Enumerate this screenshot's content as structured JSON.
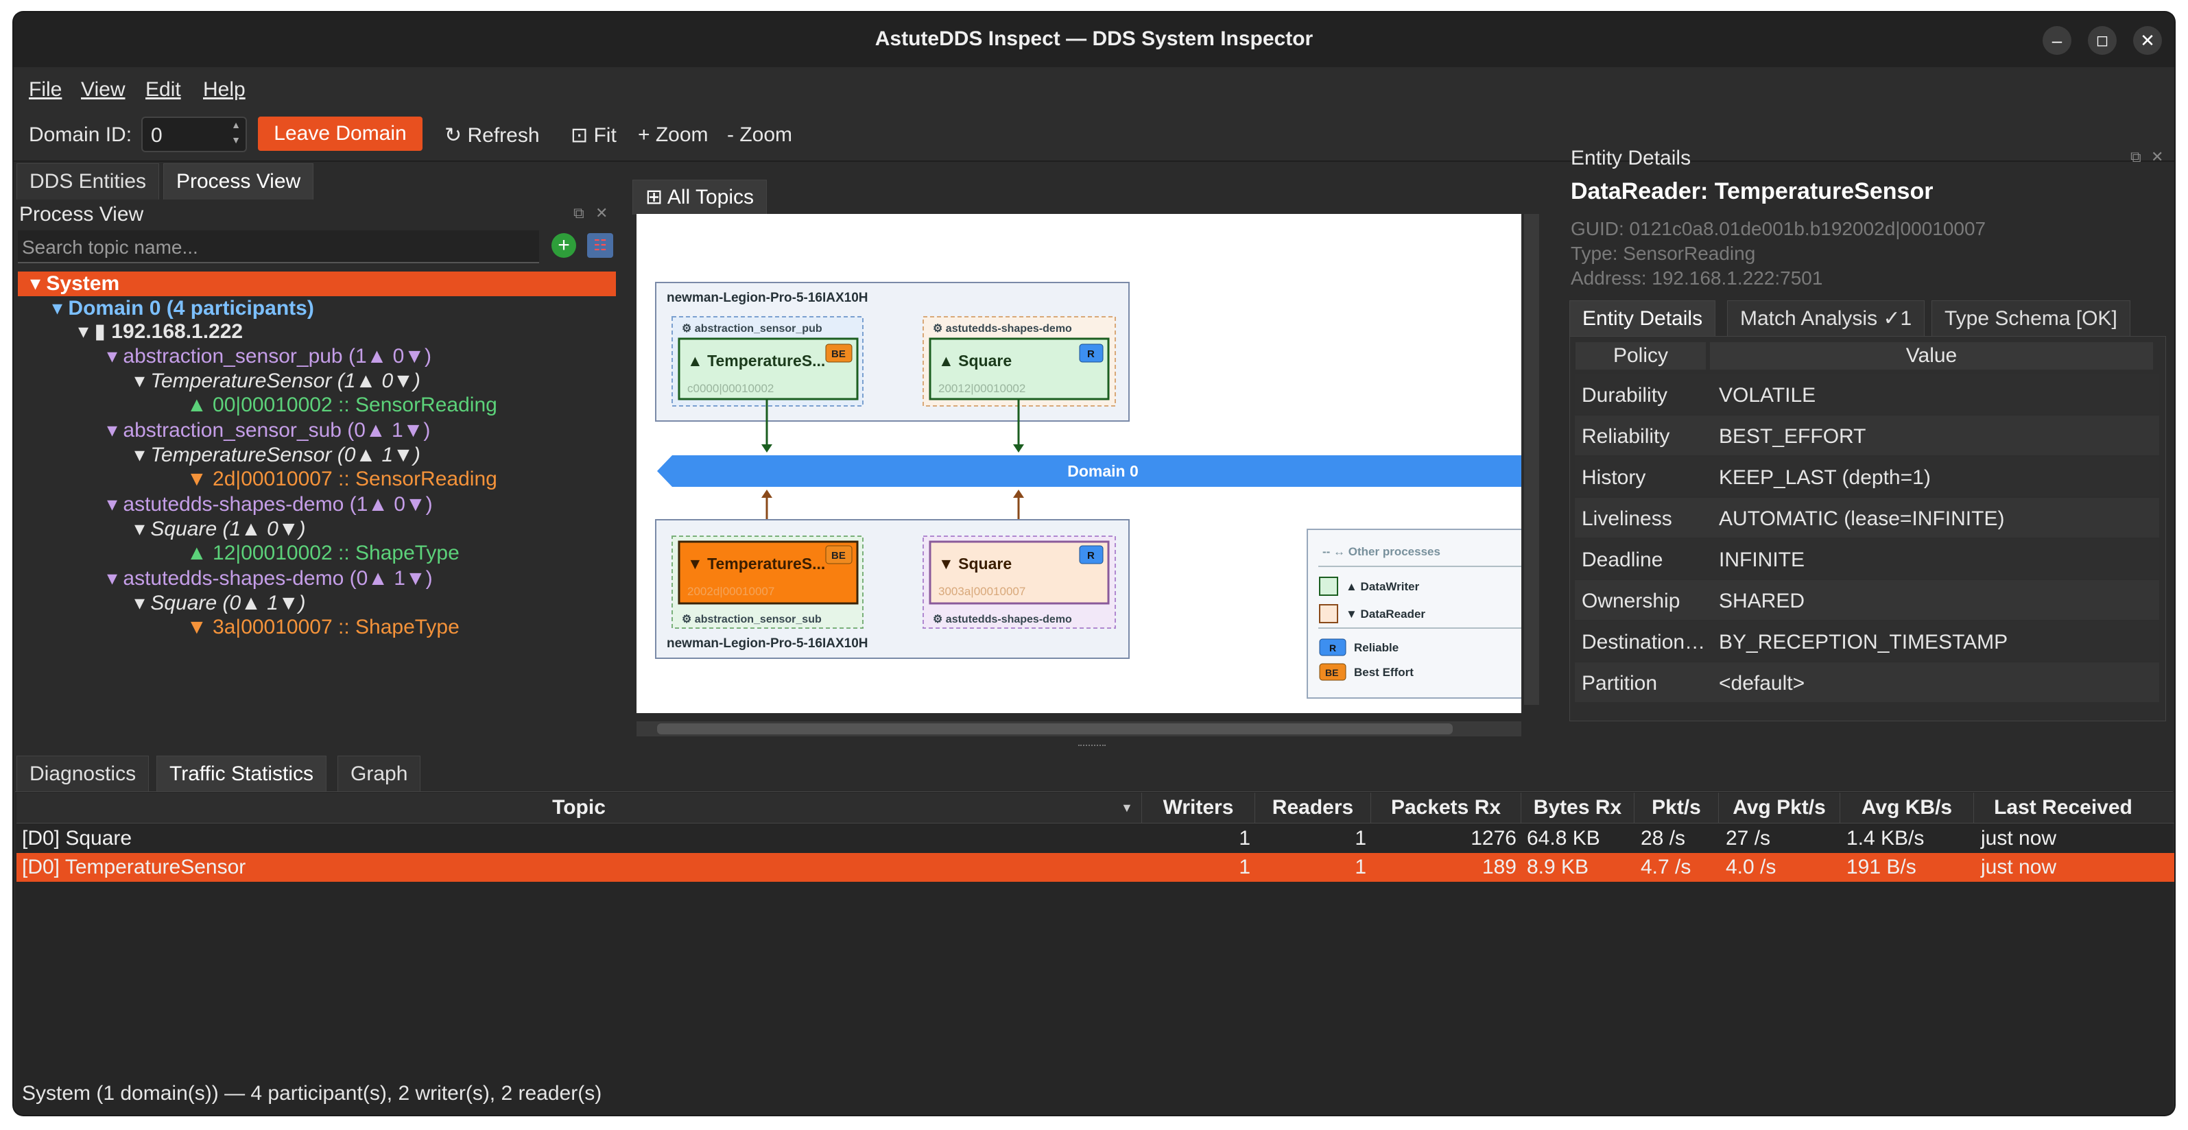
{
  "window": {
    "title": "AstuteDDS Inspect — DDS System Inspector"
  },
  "menu": [
    "File",
    "View",
    "Edit",
    "Help"
  ],
  "toolbar": {
    "domain_label": "Domain ID:",
    "domain_value": "0",
    "leave": "Leave Domain",
    "refresh": "↻ Refresh",
    "fit": "⊡ Fit",
    "zoom_in": "+ Zoom",
    "zoom_out": "- Zoom"
  },
  "left": {
    "tabs": [
      "DDS Entities",
      "Process View"
    ],
    "panel_title": "Process View",
    "search_placeholder": "Search topic name...",
    "tree": {
      "system": "System",
      "domain": "Domain 0  (4 participants)",
      "host": "192.168.1.222",
      "p1": "abstraction_sensor_pub  (1▲ 0▼)",
      "p1_topic": "TemperatureSensor  (1▲ 0▼)",
      "p1_ep": "▲ 00|00010002  :: SensorReading",
      "p2": "abstraction_sensor_sub  (0▲ 1▼)",
      "p2_topic": "TemperatureSensor  (0▲ 1▼)",
      "p2_ep": "▼ 2d|00010007  :: SensorReading",
      "p3": "astutedds-shapes-demo  (1▲ 0▼)",
      "p3_topic": "Square  (1▲ 0▼)",
      "p3_ep": "▲ 12|00010002  :: ShapeType",
      "p4": "astutedds-shapes-demo  (0▲ 1▼)",
      "p4_topic": "Square  (0▲ 1▼)",
      "p4_ep": "▼ 3a|00010007  :: ShapeType"
    }
  },
  "center": {
    "tab": "⊞ All Topics",
    "host_top": "newman-Legion-Pro-5-16IAX10H",
    "host_bottom": "newman-Legion-Pro-5-16IAX10H",
    "proc_pub": "⚙ abstraction_sensor_pub",
    "proc_shapes_top": "⚙ astutedds-shapes-demo",
    "proc_sub": "⚙ abstraction_sensor_sub",
    "proc_shapes_bottom": "⚙ astutedds-shapes-demo",
    "w1_label": "▲ TemperatureS...",
    "w1_guid": "c0000|00010002",
    "w2_label": "▲ Square",
    "w2_guid": "20012|00010002",
    "r1_label": "▼ TemperatureS...",
    "r1_guid": "2002d|00010007",
    "r2_label": "▼ Square",
    "r2_guid": "3003a|00010007",
    "badge_be": "BE",
    "badge_r": "R",
    "domain_bar": "Domain 0",
    "legend": {
      "other": "-- ↔ Other processes",
      "writer": "▲ DataWriter",
      "reader": "▼ DataReader",
      "reliable": "Reliable",
      "best_effort": "Best Effort"
    }
  },
  "right": {
    "panel_title": "Entity Details",
    "heading": "DataReader: TemperatureSensor",
    "guid": "GUID: 0121c0a8.01de001b.b192002d|00010007",
    "type": "Type: SensorReading",
    "address": "Address: 192.168.1.222:7501",
    "tabs": [
      "Entity Details",
      "Match Analysis ✓1",
      "Type Schema [OK]"
    ],
    "col_policy": "Policy",
    "col_value": "Value",
    "rows": [
      {
        "k": "Durability",
        "v": "VOLATILE"
      },
      {
        "k": "Reliability",
        "v": "BEST_EFFORT"
      },
      {
        "k": "History",
        "v": "KEEP_LAST (depth=1)"
      },
      {
        "k": "Liveliness",
        "v": "AUTOMATIC (lease=INFINITE)"
      },
      {
        "k": "Deadline",
        "v": "INFINITE"
      },
      {
        "k": "Ownership",
        "v": "SHARED"
      },
      {
        "k": "Destination…",
        "v": "BY_RECEPTION_TIMESTAMP"
      },
      {
        "k": "Partition",
        "v": "<default>"
      }
    ]
  },
  "bottom": {
    "tabs": [
      "Diagnostics",
      "Traffic Statistics",
      "Graph"
    ],
    "headers": [
      "Topic",
      "Writers",
      "Readers",
      "Packets Rx",
      "Bytes Rx",
      "Pkt/s",
      "Avg Pkt/s",
      "Avg KB/s",
      "Last Received"
    ],
    "rows": [
      [
        "[D0] Square",
        "1",
        "1",
        "1276",
        "64.8 KB",
        "28 /s",
        "27 /s",
        "1.4 KB/s",
        "just now"
      ],
      [
        "[D0] TemperatureSensor",
        "1",
        "1",
        "189",
        "8.9 KB",
        "4.7 /s",
        "4.0 /s",
        "191 B/s",
        "just now"
      ]
    ],
    "status": "System (1 domain(s)) — 4 participant(s), 2 writer(s), 2 reader(s)"
  },
  "colors": {
    "accent": "#e8501f",
    "domain_bar": "#3d8ff0",
    "writer_fill": "#d8f3dc",
    "reader_fill": "#f97f0f"
  }
}
